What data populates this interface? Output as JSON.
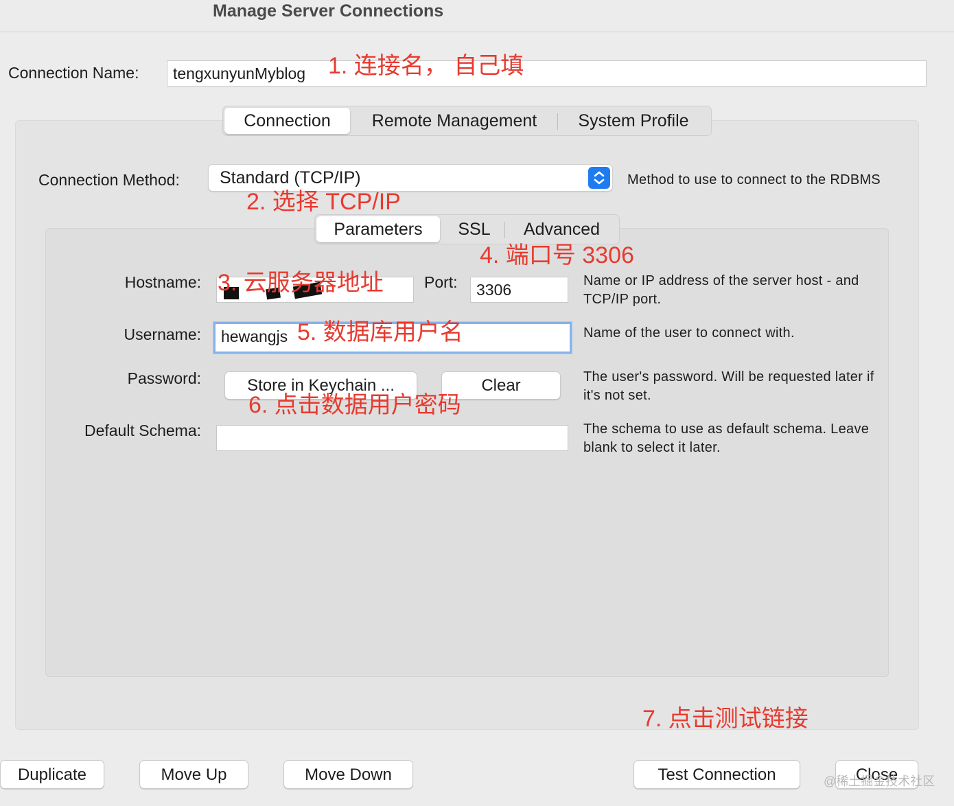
{
  "window": {
    "title": "Manage Server Connections"
  },
  "connection_name": {
    "label": "Connection Name:",
    "value": "tengxunyunMyblog"
  },
  "main_tabs": [
    {
      "label": "Connection",
      "active": true
    },
    {
      "label": "Remote Management",
      "active": false
    },
    {
      "label": "System Profile",
      "active": false
    }
  ],
  "connection_method": {
    "label": "Connection Method:",
    "value": "Standard (TCP/IP)",
    "description": "Method to use to connect to the RDBMS"
  },
  "sub_tabs": [
    {
      "label": "Parameters",
      "active": true
    },
    {
      "label": "SSL",
      "active": false
    },
    {
      "label": "Advanced",
      "active": false
    }
  ],
  "hostname": {
    "label": "Hostname:",
    "value": "",
    "description": "Name or IP address of the server host - and TCP/IP port."
  },
  "port": {
    "label": "Port:",
    "value": "3306"
  },
  "username": {
    "label": "Username:",
    "value": "hewangjs",
    "description": "Name of the user to connect with."
  },
  "password": {
    "label": "Password:",
    "store_button": "Store in Keychain ...",
    "clear_button": "Clear",
    "description": "The user's password. Will be requested later if it's not set."
  },
  "default_schema": {
    "label": "Default Schema:",
    "value": "",
    "description": "The schema to use as default schema. Leave blank to select it later."
  },
  "footer_buttons": {
    "duplicate": "Duplicate",
    "move_up": "Move Up",
    "move_down": "Move Down",
    "test_connection": "Test Connection",
    "close": "Close"
  },
  "annotations": {
    "a1": "1. 连接名， 自己填",
    "a2": "2. 选择 TCP/IP",
    "a3": "3. 云服务器地址",
    "a4": "4. 端口号 3306",
    "a5": "5. 数据库用户名",
    "a6": "6. 点击数据用户密码",
    "a7": "7. 点击测试链接"
  },
  "watermark": "@稀土掘金技术社区",
  "colors": {
    "annotation": "#e83a2f",
    "accent": "#1f7cf0",
    "focus_ring": "#86b3ea"
  }
}
